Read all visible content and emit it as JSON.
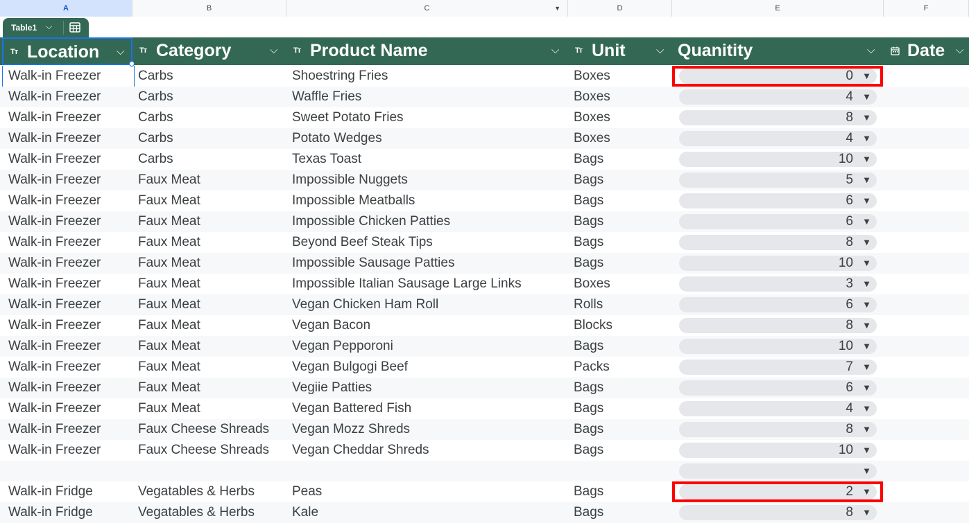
{
  "columns": [
    "A",
    "B",
    "C",
    "D",
    "E",
    "F"
  ],
  "table_name": "Table1",
  "headers": [
    {
      "label": "Location",
      "type_icon": "Tт"
    },
    {
      "label": "Category",
      "type_icon": "Tт"
    },
    {
      "label": "Product Name",
      "type_icon": "Tт"
    },
    {
      "label": "Unit",
      "type_icon": "Tт"
    },
    {
      "label": "Quanitity",
      "type_icon": ""
    },
    {
      "label": "Date",
      "type_icon": "calendar"
    }
  ],
  "rows": [
    {
      "location": "Walk-in Freezer",
      "category": "Carbs",
      "product": "Shoestring Fries",
      "unit": "Boxes",
      "quantity": "0",
      "highlight": true
    },
    {
      "location": "Walk-in Freezer",
      "category": "Carbs",
      "product": "Waffle Fries",
      "unit": "Boxes",
      "quantity": "4"
    },
    {
      "location": "Walk-in Freezer",
      "category": "Carbs",
      "product": "Sweet Potato Fries",
      "unit": "Boxes",
      "quantity": "8"
    },
    {
      "location": "Walk-in Freezer",
      "category": "Carbs",
      "product": "Potato Wedges",
      "unit": "Boxes",
      "quantity": "4"
    },
    {
      "location": "Walk-in Freezer",
      "category": "Carbs",
      "product": "Texas Toast",
      "unit": "Bags",
      "quantity": "10"
    },
    {
      "location": "Walk-in Freezer",
      "category": "Faux Meat",
      "product": "Impossible Nuggets",
      "unit": "Bags",
      "quantity": "5"
    },
    {
      "location": "Walk-in Freezer",
      "category": "Faux Meat",
      "product": "Impossible Meatballs",
      "unit": "Bags",
      "quantity": "6"
    },
    {
      "location": "Walk-in Freezer",
      "category": "Faux Meat",
      "product": "Impossible Chicken Patties",
      "unit": "Bags",
      "quantity": "6"
    },
    {
      "location": "Walk-in Freezer",
      "category": "Faux Meat",
      "product": "Beyond Beef Steak Tips",
      "unit": "Bags",
      "quantity": "8"
    },
    {
      "location": "Walk-in Freezer",
      "category": "Faux Meat",
      "product": "Impossible Sausage Patties",
      "unit": "Bags",
      "quantity": "10"
    },
    {
      "location": "Walk-in Freezer",
      "category": "Faux Meat",
      "product": "Impossible Italian Sausage Large Links",
      "unit": "Boxes",
      "quantity": "3"
    },
    {
      "location": "Walk-in Freezer",
      "category": "Faux Meat",
      "product": "Vegan Chicken Ham Roll",
      "unit": "Rolls",
      "quantity": "6"
    },
    {
      "location": "Walk-in Freezer",
      "category": "Faux Meat",
      "product": "Vegan Bacon",
      "unit": "Blocks",
      "quantity": "8"
    },
    {
      "location": "Walk-in Freezer",
      "category": "Faux Meat",
      "product": "Vegan Pepporoni",
      "unit": "Bags",
      "quantity": "10"
    },
    {
      "location": "Walk-in Freezer",
      "category": "Faux Meat",
      "product": "Vegan Bulgogi Beef",
      "unit": "Packs",
      "quantity": "7"
    },
    {
      "location": "Walk-in Freezer",
      "category": "Faux Meat",
      "product": "Vegiie Patties",
      "unit": "Bags",
      "quantity": "6"
    },
    {
      "location": "Walk-in Freezer",
      "category": "Faux Meat",
      "product": "Vegan Battered Fish",
      "unit": "Bags",
      "quantity": "4"
    },
    {
      "location": "Walk-in Freezer",
      "category": "Faux Cheese Shreads",
      "product": "Vegan Mozz Shreds",
      "unit": "Bags",
      "quantity": "8"
    },
    {
      "location": "Walk-in Freezer",
      "category": "Faux Cheese Shreads",
      "product": "Vegan Cheddar Shreds",
      "unit": "Bags",
      "quantity": "10"
    },
    {
      "location": "",
      "category": "",
      "product": "",
      "unit": "",
      "quantity": ""
    },
    {
      "location": "Walk-in Fridge",
      "category": "Vegatables & Herbs",
      "product": "Peas",
      "unit": "Bags",
      "quantity": "2",
      "highlight": true
    },
    {
      "location": "Walk-in Fridge",
      "category": "Vegatables & Herbs",
      "product": "Kale",
      "unit": "Bags",
      "quantity": "8"
    }
  ],
  "colors": {
    "header_bg": "#336854",
    "highlight": "#ff0000",
    "selection": "#1a73e8"
  }
}
